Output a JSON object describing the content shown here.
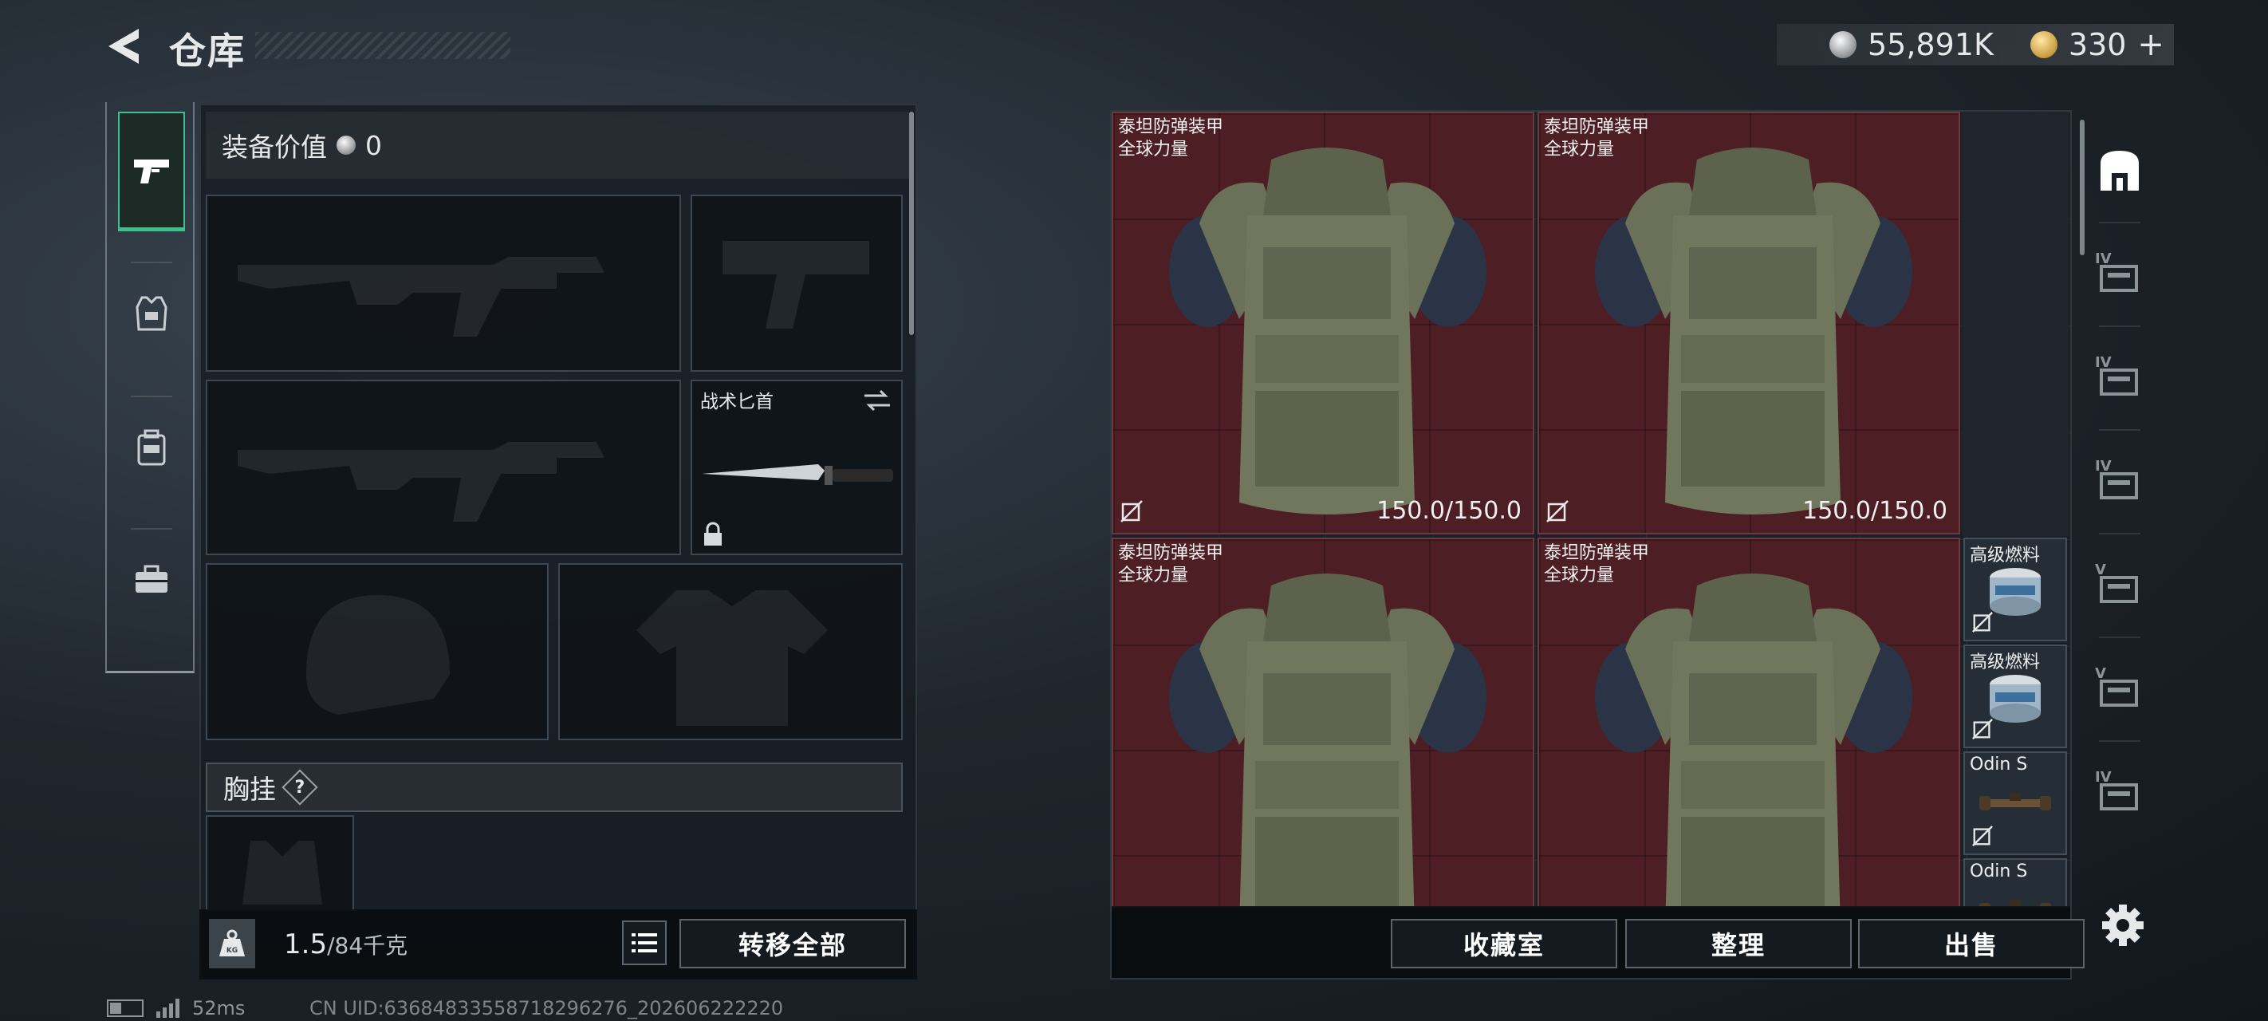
{
  "header": {
    "title": "仓库",
    "silver_amount": "55,891K",
    "gold_amount": "330",
    "add_label": "+"
  },
  "left_tabs": [
    {
      "name": "weapon-tab",
      "icon": "pistol-icon",
      "active": true
    },
    {
      "name": "armor-tab",
      "icon": "vest-icon",
      "active": false
    },
    {
      "name": "backpack-tab",
      "icon": "backpack-icon",
      "active": false
    },
    {
      "name": "case-tab",
      "icon": "briefcase-icon",
      "active": false
    }
  ],
  "equipment": {
    "value_label": "装备价值",
    "value": "0",
    "knife_label": "战术匕首",
    "chest_rig_label": "胸挂",
    "help_label": "?",
    "weight_current": "1.5",
    "weight_max": "/84千克",
    "transfer_all": "转移全部"
  },
  "stash": {
    "armor_items": [
      {
        "name_line1": "泰坦防弹装甲",
        "name_line2": "全球力量",
        "durability": "150.0/150.0"
      },
      {
        "name_line1": "泰坦防弹装甲",
        "name_line2": "全球力量",
        "durability": "150.0/150.0"
      },
      {
        "name_line1": "泰坦防弹装甲",
        "name_line2": "全球力量",
        "durability": ""
      },
      {
        "name_line1": "泰坦防弹装甲",
        "name_line2": "全球力量",
        "durability": ""
      }
    ],
    "small_items": [
      {
        "name": "高级燃料"
      },
      {
        "name": "高级燃料"
      },
      {
        "name": "Odin S"
      },
      {
        "name": "Odin S"
      }
    ]
  },
  "actions": {
    "collection": "收藏室",
    "sort": "整理",
    "sell": "出售"
  },
  "side_tabs": {
    "levels": [
      "IV",
      "IV",
      "IV",
      "V",
      "V",
      "IV"
    ]
  },
  "status": {
    "ping": "52ms",
    "uid": "CN UID:63684833558718296276_202606222220"
  },
  "colors": {
    "accent_green": "#3fbe8e",
    "armor_cell_red": "#4d1e23"
  }
}
